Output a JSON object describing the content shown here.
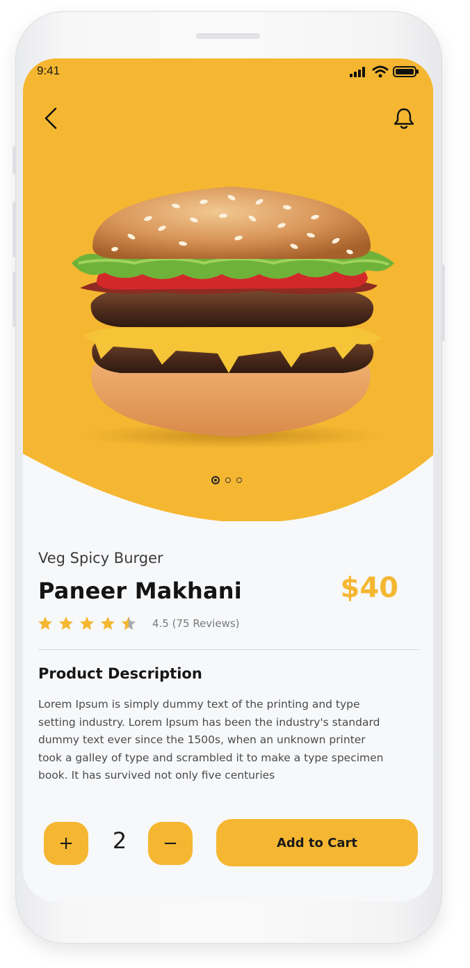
{
  "status_bar": {
    "time": "9:41"
  },
  "header": {
    "back_icon": "chevron-left-icon",
    "notification_icon": "bell-icon"
  },
  "hero": {
    "background_color": "#f5b731",
    "image_subject": "burger-image",
    "carousel": {
      "count": 3,
      "active_index": 0
    }
  },
  "product": {
    "subtitle": "Veg Spicy Burger",
    "name": "Paneer Makhani",
    "price": "$40",
    "rating_value": 4.5,
    "rating_text": "4.5 (75 Reviews)",
    "stars_max": 5
  },
  "description": {
    "heading": "Product Description",
    "lines": [
      "Lorem Ipsum is simply dummy text of the printing and type",
      "setting industry. Lorem Ipsum has been the industry's standard",
      "dummy text ever since the 1500s, when an unknown printer",
      "took a galley of type and scrambled it to make a type specimen",
      "book. It has survived not only five centuries"
    ]
  },
  "cart": {
    "plus_label": "+",
    "minus_label": "−",
    "quantity": "2",
    "add_label": "Add to Cart"
  },
  "colors": {
    "accent": "#f5b731",
    "text_dark": "#141414",
    "text_muted": "#7a7a7a",
    "screen_bg": "#f7f8fa"
  }
}
